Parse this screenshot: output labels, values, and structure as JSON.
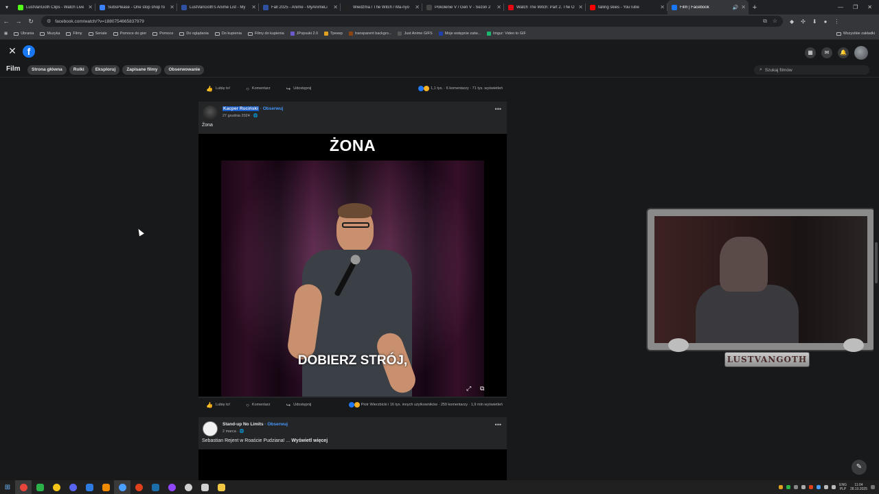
{
  "browser": {
    "tabs": [
      {
        "title": "LustVanGoth Clips - Watch Live",
        "color": "#53fc18"
      },
      {
        "title": "SubsPlease - One stop shop fo",
        "color": "#3b82f6"
      },
      {
        "title": "LustVanGoth's Anime List - My",
        "color": "#2e51a2"
      },
      {
        "title": "Fall 2025 - Anime - MyAnimeLi",
        "color": "#2e51a2"
      },
      {
        "title": "Wiedźma / The Witch / Ma-nyo",
        "color": "#222222"
      },
      {
        "title": "Pokolenie V / Gen V - Sezon 2",
        "color": "#444444"
      },
      {
        "title": "Watch The Witch: Part 2. The O",
        "color": "#e50914"
      },
      {
        "title": "falling skies - YouTube",
        "color": "#ff0000"
      },
      {
        "title": "Film | Facebook",
        "color": "#1877f2",
        "active": true
      }
    ],
    "url": "facebook.com/watch/?v=1880754665837979",
    "bookmarks": [
      {
        "label": "Ubrania",
        "type": "folder"
      },
      {
        "label": "Muzyka",
        "type": "folder"
      },
      {
        "label": "Filmy",
        "type": "folder"
      },
      {
        "label": "Seriale",
        "type": "folder"
      },
      {
        "label": "Pomoce do gier",
        "type": "folder"
      },
      {
        "label": "Pomoce",
        "type": "folder"
      },
      {
        "label": "Do oglądania",
        "type": "folder"
      },
      {
        "label": "Do kupienia",
        "type": "folder"
      },
      {
        "label": "Filmy do kupienia",
        "type": "folder"
      },
      {
        "label": "JPopsuki 2.0",
        "type": "site",
        "color": "#6a5acd"
      },
      {
        "label": "Трекер",
        "type": "site",
        "color": "#e0a020"
      },
      {
        "label": "transparent backgro...",
        "type": "site",
        "color": "#8b4513"
      },
      {
        "label": "Just Anime GIFS",
        "type": "site",
        "color": "#555555"
      },
      {
        "label": "Moje wstępnie zatw...",
        "type": "site",
        "color": "#1e40af"
      },
      {
        "label": "Imgur: Video to GIF",
        "type": "site",
        "color": "#1bb76e"
      }
    ],
    "bookmarks_all": "Wszystkie zakładki"
  },
  "fb": {
    "logo": "f",
    "section_title": "Film",
    "nav": [
      "Strona główna",
      "Rolki",
      "Eksploruj",
      "Zapisane filmy",
      "Obserwowanie"
    ],
    "search_placeholder": "Szukaj filmów"
  },
  "actions": {
    "like": "Lubię to!",
    "comment": "Komentarz",
    "share": "Udostępnij"
  },
  "top_stats": "1,1 tys. · 6 komentarzy · 71 tys. wyświetleń",
  "post1": {
    "author": "Kacper Ruciński",
    "follow": "· Obserwuj",
    "date": "27 grudnia 2024 · 🌐",
    "caption": "Żona",
    "video_title": "ŻONA",
    "subtitle": "DOBIERZ STRÓJ,",
    "stats": "Piotr Wierzbicki i 16 tys. innych użytkowników · 259 komentarzy · 1,9 mln wyświetleń"
  },
  "post2": {
    "author": "Stand-up No Limits",
    "follow": "· Obserwuj",
    "date": "2 marca · 🌐",
    "caption": "Sebastian Rejent w Roaście Pudziana! ...",
    "more": "Wyświetl więcej"
  },
  "overlay": {
    "name": "LUSTVANGOTH"
  },
  "tray": {
    "lang1": "ENG",
    "lang2": "PLP",
    "time": "11:04",
    "date": "28.10.2025"
  }
}
